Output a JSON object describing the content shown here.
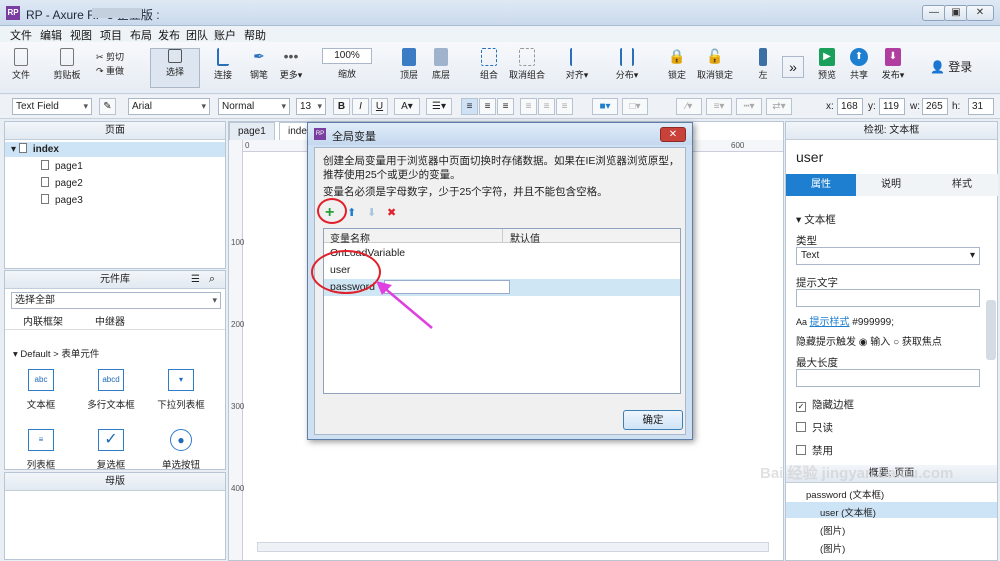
{
  "window": {
    "title": "RP - Axure RP 8 企业版 :",
    "minimize": "—",
    "restore": "▣",
    "close": "✕"
  },
  "menu": [
    "文件",
    "编辑",
    "视图",
    "项目",
    "布局",
    "发布",
    "团队",
    "账户",
    "帮助"
  ],
  "toolbar": {
    "file": "文件",
    "clipboard": "剪贴板",
    "cut": "剪切",
    "redo": "重做",
    "select": "选择",
    "connect": "连接",
    "pen": "钢笔",
    "more": "更多▾",
    "zoom_value": "100%",
    "zoom": "缩放",
    "top": "顶层",
    "bottom": "底层",
    "group": "组合",
    "ungroup": "取消组合",
    "align": "对齐▾",
    "distribute": "分布▾",
    "lock": "锁定",
    "unlock": "取消锁定",
    "left": "左",
    "preview": "预览",
    "share": "共享",
    "publish": "发布▾",
    "login": "登录"
  },
  "formatbar": {
    "widget_type": "Text Field",
    "font": "Arial",
    "style": "Normal",
    "size": "13",
    "bold": "B",
    "italic": "I",
    "underline": "U",
    "x_label": "x:",
    "x": "168",
    "y_label": "y:",
    "y": "119",
    "w_label": "w:",
    "w": "265",
    "h_label": "h:",
    "h": "31"
  },
  "pages": {
    "header": "页面",
    "root": "index",
    "children": [
      "page1",
      "page2",
      "page3"
    ]
  },
  "library": {
    "header": "元件库",
    "select": "选择全部",
    "row0": [
      "内联框架",
      "中继器"
    ],
    "group": "Default > 表单元件",
    "widgets": [
      {
        "label": "文本框",
        "icon": "abc"
      },
      {
        "label": "多行文本框",
        "icon": "abcd"
      },
      {
        "label": "下拉列表框",
        "icon": "▾"
      },
      {
        "label": "列表框",
        "icon": "≡"
      },
      {
        "label": "复选框",
        "icon": "✓"
      },
      {
        "label": "单选按钮",
        "icon": "●"
      }
    ]
  },
  "masters": {
    "header": "母版"
  },
  "canvas": {
    "tabs": [
      "page1",
      "inde"
    ],
    "ruler_h": [
      "0",
      "100",
      "600"
    ],
    "ruler_v": [
      "100",
      "200",
      "300",
      "400"
    ]
  },
  "dialog": {
    "title": "全局变量",
    "close": "✕",
    "desc": "创建全局变量用于浏览器中页面切换时存储数据。如果在IE浏览器浏览原型，推荐使用25个或更少的变量。",
    "rule": "变量名必须是字母数字，少于25个字符，并且不能包含空格。",
    "add": "+",
    "up": "⬆",
    "down": "⬇",
    "remove": "✖",
    "col_name": "变量名称",
    "col_default": "默认值",
    "rows": [
      "OnLoadVariable",
      "user",
      "password"
    ],
    "ok": "确定"
  },
  "inspector": {
    "header": "检视: 文本框",
    "name": "user",
    "tabs": [
      "属性",
      "说明",
      "样式"
    ],
    "section": "文本框",
    "type_label": "类型",
    "type_value": "Text",
    "hint_label": "提示文字",
    "hint_style_link": "提示样式",
    "hint_color": "#999999;",
    "hide_hint_label": "隐藏提示触发",
    "radio_input": "输入",
    "radio_focus": "获取焦点",
    "maxlen_label": "最大长度",
    "hide_border": "隐藏边框",
    "readonly": "只读",
    "disabled": "禁用"
  },
  "outline": {
    "header": "概要: 页面",
    "items": [
      "password (文本框)",
      "user (文本框)",
      "(图片)",
      "(图片)"
    ]
  },
  "watermark": "Bai 经验 jingyan.baidu.com",
  "colors": {
    "accent": "#1e7fd0",
    "annotation": "#e0202a",
    "arrow": "#e040e0"
  }
}
